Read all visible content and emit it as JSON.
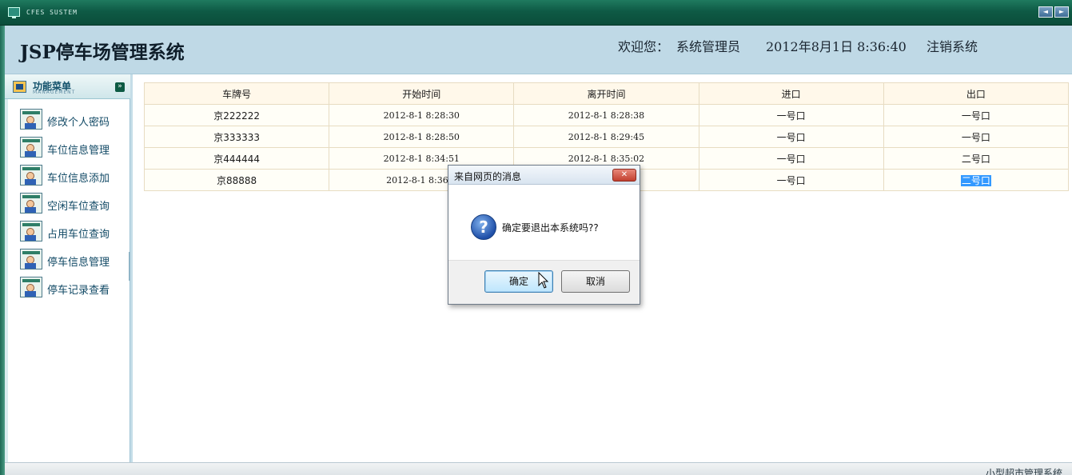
{
  "topbar": {
    "system_label": "CFES SUSTEM",
    "nav_left": "◄",
    "nav_right": "►"
  },
  "header": {
    "title": "JSP停车场管理系统",
    "welcome": "欢迎您：",
    "user": "系统管理员",
    "datetime": "2012年8月1日  8:36:40",
    "logout": "注销系统"
  },
  "sidebar": {
    "title": "功能菜单",
    "subtitle": "MANAGEMENT",
    "collapse_icon": "double-chevron-down-icon",
    "items": [
      {
        "label": "修改个人密码"
      },
      {
        "label": "车位信息管理"
      },
      {
        "label": "车位信息添加"
      },
      {
        "label": "空闲车位查询"
      },
      {
        "label": "占用车位查询"
      },
      {
        "label": "停车信息管理"
      },
      {
        "label": "停车记录查看"
      }
    ]
  },
  "table": {
    "headers": [
      "车牌号",
      "开始时间",
      "离开时间",
      "进口",
      "出口"
    ],
    "rows": [
      [
        "京222222",
        "2012-8-1 8:28:30",
        "2012-8-1 8:28:38",
        "一号口",
        "一号口"
      ],
      [
        "京333333",
        "2012-8-1 8:28:50",
        "2012-8-1 8:29:45",
        "一号口",
        "一号口"
      ],
      [
        "京444444",
        "2012-8-1 8:34:51",
        "2012-8-1 8:35:02",
        "一号口",
        "二号口"
      ],
      [
        "京88888",
        "2012-8-1 8:36:0",
        "",
        "一号口",
        "二号口"
      ]
    ]
  },
  "dialog": {
    "title": "来自网页的消息",
    "close": "✕",
    "icon": "question-icon",
    "message": "确定要退出本系统吗??",
    "ok_label": "确定",
    "cancel_label": "取消"
  },
  "footer": {
    "text": "小型超市管理系统"
  },
  "colors": {
    "topbar": "#0e5a45",
    "header": "#bfd9e6",
    "selection": "#3399ff"
  }
}
